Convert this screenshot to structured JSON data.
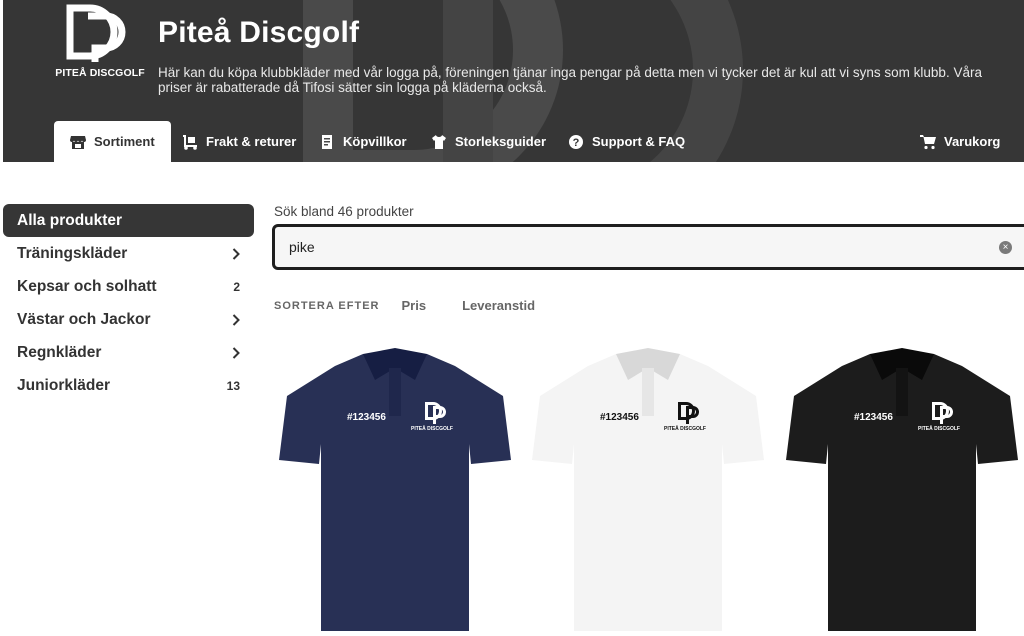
{
  "header": {
    "brand": "PITEÅ DISCGOLF",
    "title": "Piteå Discgolf",
    "description": "Här kan du köpa klubbkläder med vår logga på, föreningen tjänar inga pengar på detta men vi tycker det är kul att vi syns som klubb. Våra priser är rabatterade då Tifosi sätter sin logga på kläderna också."
  },
  "nav": {
    "tabs": [
      {
        "label": "Sortiment",
        "icon": "store-icon"
      },
      {
        "label": "Frakt & returer",
        "icon": "dolly-icon"
      },
      {
        "label": "Köpvillkor",
        "icon": "contract-icon"
      },
      {
        "label": "Storleksguider",
        "icon": "tshirt-icon"
      },
      {
        "label": "Support & FAQ",
        "icon": "help-icon"
      }
    ],
    "cart": {
      "label": "Varukorg",
      "icon": "cart-icon"
    }
  },
  "sidebar": {
    "items": [
      {
        "label": "Alla produkter",
        "active": true
      },
      {
        "label": "Träningskläder",
        "indicator": "chevron"
      },
      {
        "label": "Kepsar och solhatt",
        "count": "2"
      },
      {
        "label": "Västar och Jackor",
        "indicator": "chevron"
      },
      {
        "label": "Regnkläder",
        "indicator": "chevron"
      },
      {
        "label": "Juniorkläder",
        "count": "13"
      }
    ]
  },
  "search": {
    "label": "Sök bland 46 produkter",
    "value": "pike"
  },
  "sort": {
    "label": "SORTERA EFTER",
    "options": [
      "Pris",
      "Leveranstid"
    ]
  },
  "products": [
    {
      "color": "#283055",
      "print_color": "#ffffff",
      "number": "#123456",
      "brand": "PITEÅ DISCGOLF"
    },
    {
      "color": "#f4f4f4",
      "print_color": "#111111",
      "number": "#123456",
      "brand": "PITEÅ DISCGOLF"
    },
    {
      "color": "#1c1c1c",
      "print_color": "#ffffff",
      "number": "#123456",
      "brand": "PITEÅ DISCGOLF"
    }
  ]
}
